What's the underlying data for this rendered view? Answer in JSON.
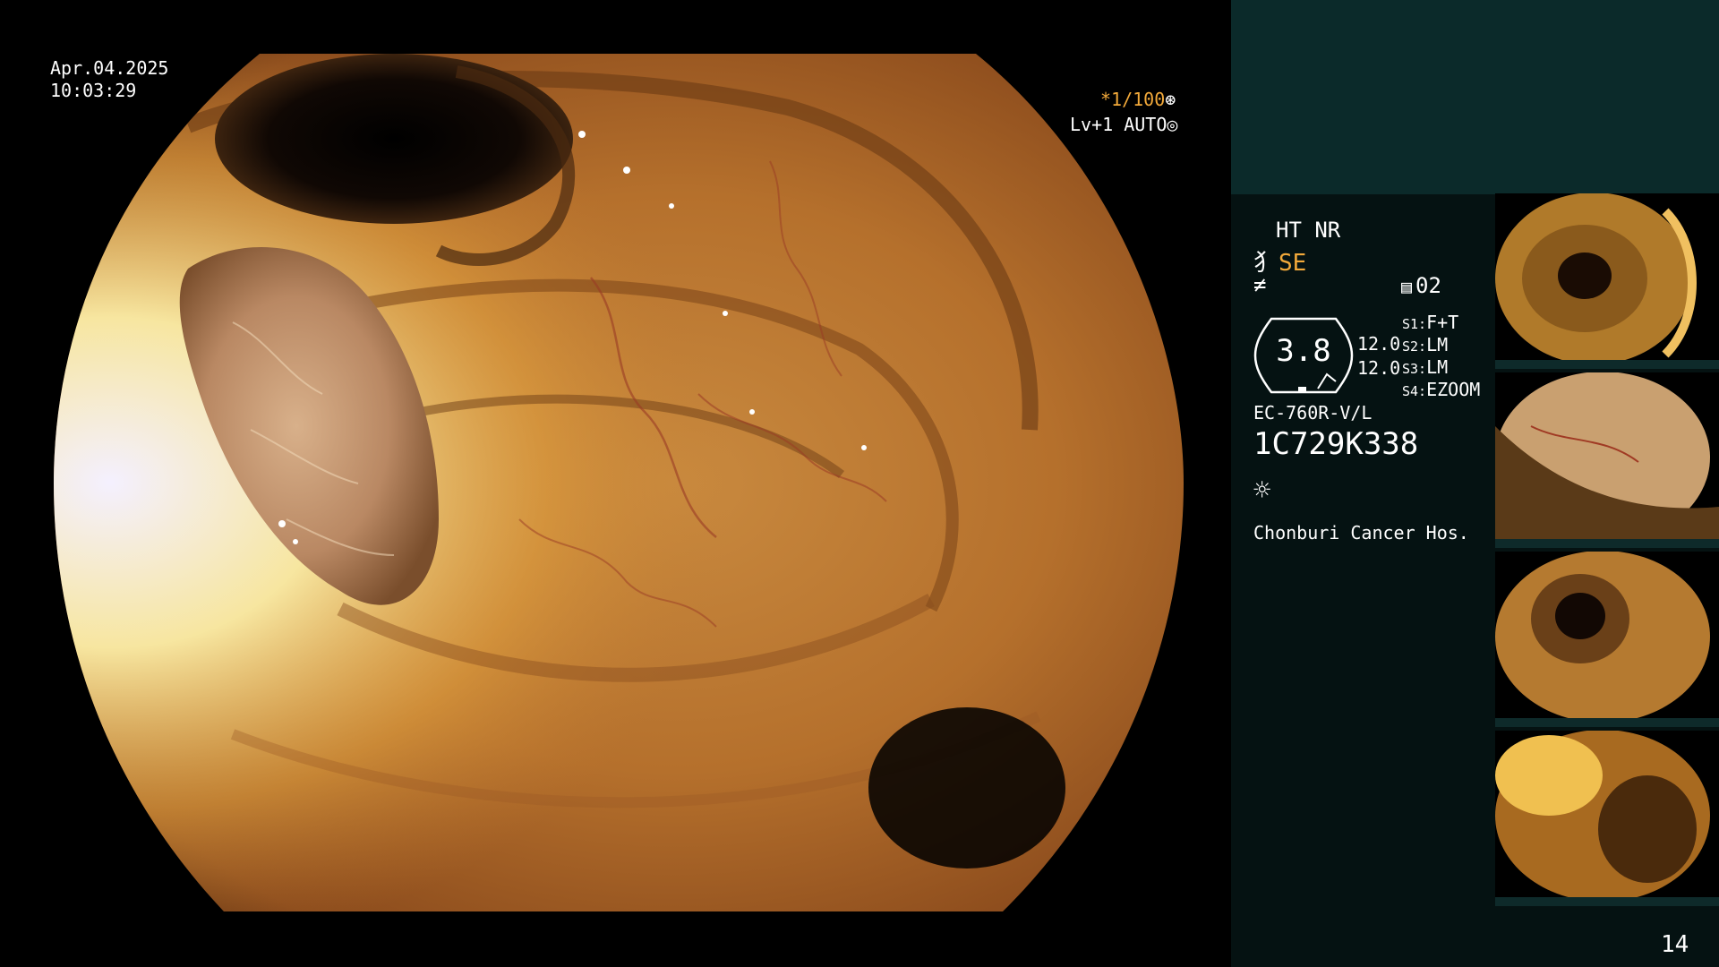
{
  "overlay": {
    "date": "Apr.04.2025",
    "time": "10:03:29",
    "shutter": "*1/100",
    "shutter_icon": "aperture-icon",
    "level": "Lv+1 AUTO",
    "level_icon": "iris-icon"
  },
  "panel": {
    "ht_nr": "HT NR",
    "se_label": "SE",
    "memory_label": "02",
    "hex_value": "3.8",
    "value_a": "12.0",
    "value_b": "12.0",
    "switches": [
      {
        "key": "S1:",
        "value": "F+T"
      },
      {
        "key": "S2:",
        "value": "LM"
      },
      {
        "key": "S3:",
        "value": "LM"
      },
      {
        "key": "S4:",
        "value": "EZOOM"
      }
    ],
    "scope_model": "EC-760R-V/L",
    "serial": "1C729K338",
    "hospital": "Chonburi Cancer Hos.",
    "page_number": "14"
  },
  "colors": {
    "accent_orange": "#f2a93a",
    "panel_top": "#0b2a2a",
    "panel_bottom": "#051212"
  }
}
